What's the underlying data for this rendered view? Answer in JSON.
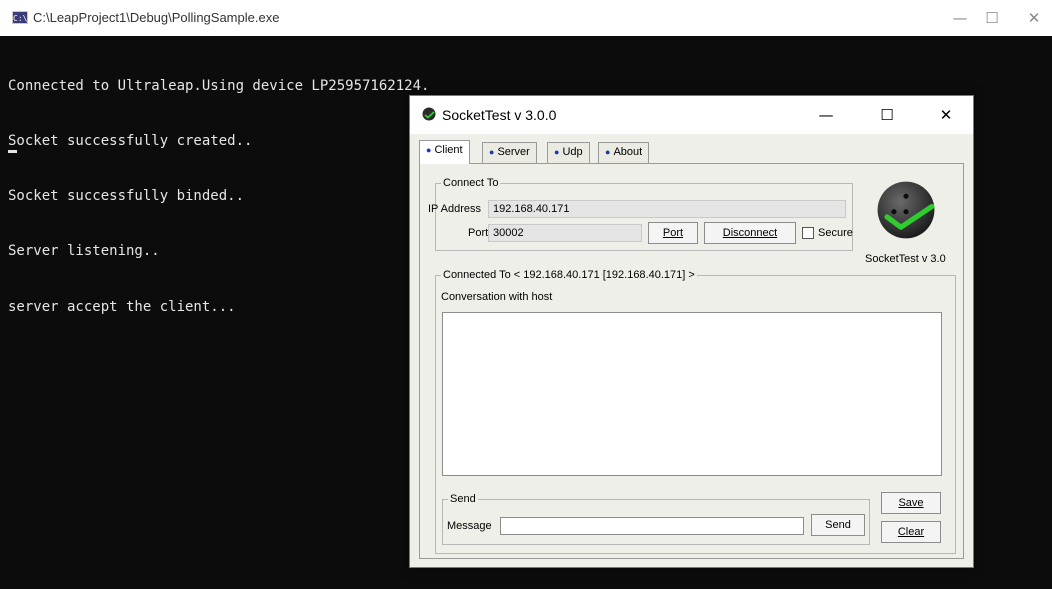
{
  "console": {
    "icon_text": "C:\\",
    "title": "C:\\LeapProject1\\Debug\\PollingSample.exe",
    "lines": [
      "Connected to Ultraleap.Using device LP25957162124.",
      "Socket successfully created..",
      "Socket successfully binded..",
      "Server listening..",
      "server accept the client..."
    ],
    "controls": {
      "minimize": "—",
      "maximize": "☐",
      "close": "✕"
    }
  },
  "sockettest": {
    "title": "SocketTest v 3.0.0",
    "controls": {
      "minimize": "—",
      "maximize": "☐",
      "close": "✕"
    },
    "tabs": [
      {
        "label": "Client",
        "active": true
      },
      {
        "label": "Server",
        "active": false
      },
      {
        "label": "Udp",
        "active": false
      },
      {
        "label": "About",
        "active": false
      }
    ],
    "connect_to": {
      "legend": "Connect To",
      "ip_label": "IP Address",
      "ip_value": "192.168.40.171",
      "port_label": "Port",
      "port_value": "30002",
      "port_button": "Port",
      "disconnect_button": "Disconnect",
      "secure_label": "Secure",
      "secure_checked": false
    },
    "logo_caption": "SocketTest v 3.0",
    "connected": {
      "legend": "Connected To <  192.168.40.171 [192.168.40.171]  >",
      "conversation_label": "Conversation with host",
      "conversation_text": ""
    },
    "send": {
      "legend": "Send",
      "message_label": "Message",
      "message_value": "",
      "send_button": "Send"
    },
    "save_button": "Save",
    "clear_button": "Clear",
    "colors": {
      "tab_dot": "#1a3ca6",
      "logo_check": "#2ecc2e",
      "console_bg": "#0c0c0c"
    }
  }
}
